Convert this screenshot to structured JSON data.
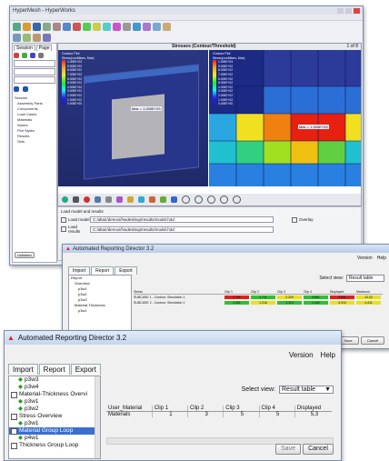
{
  "bg_window": {
    "title": "HyperMesh - HyperWorks",
    "sidebar_tabs": [
      "Session",
      "Page"
    ],
    "tree_items": [
      "Session",
      "Assembly Parts",
      "Components",
      "Load Cases",
      "Materials",
      "Nodes",
      "Plot Styles",
      "Results",
      "Sets"
    ],
    "viewport_title": "Stresses (Contour/Threshold)",
    "page_label": "1 of 8",
    "legend_left_title": "Contour Plot",
    "legend_left_sub": "Stress(vonMises, Max)",
    "legend_left_values": [
      "1.000E+03",
      "9.000E+02",
      "8.000E+02",
      "7.000E+02",
      "6.000E+02",
      "5.000E+02",
      "4.000E+02",
      "3.000E+02",
      "2.000E+02",
      "1.000E+02",
      "0.000E+00"
    ],
    "legend_right_title": "Contour Plot",
    "legend_right_sub": "Stress(vonMises, Max)",
    "legend_right_values": [
      "1.000E+03",
      "9.000E+02",
      "8.000E+02",
      "7.000E+02",
      "6.000E+02",
      "5.000E+02",
      "4.000E+02",
      "3.000E+02",
      "2.000E+02",
      "1.000E+02",
      "0.000E+00"
    ],
    "tag_left": "Max = 1.000E+03",
    "tag_right": "Max = 1.000E+03",
    "load_label": "Load model and results",
    "load_model_label": "Load model",
    "load_results_label": "Load results",
    "model_path": "C:/altair/demos/hwdesktop/results/model.h3d",
    "results_path": "C:/altair/demos/hwdesktop/results/model.h3d",
    "overlay_label": "Overlay",
    "bottom_btn": "Unlinked"
  },
  "mid_window": {
    "title": "Automated Reporting Director 3.2",
    "menu": [
      "Version",
      "Help"
    ],
    "tabs": [
      "Import",
      "Report",
      "Export"
    ],
    "tree": [
      "Report",
      "Overview",
      "p3w1",
      "p3w2",
      "p3w3",
      "Material-Thickness",
      "p3w1"
    ],
    "select_view_label": "Select view:",
    "select_view_value": "Result table",
    "table_header": [
      "Stress",
      "Clip 1",
      "Clip 2",
      "Clip 3",
      "Clip 4",
      "Displayed",
      "Maximum"
    ],
    "rows": [
      {
        "label": "SUBCASE 1 - Contour: Simulation 1",
        "cells": [
          "2.101",
          "1.711",
          "2.320",
          "5.891",
          "3.841",
          "12.42"
        ]
      },
      {
        "label": "SUBCASE 2 - Contour: Simulation 1",
        "cells": [
          "1.431",
          "1.216",
          "1.110",
          "1.402",
          "4.910",
          "4.411"
        ]
      }
    ],
    "save_label": "Save",
    "cancel_label": "Cancel"
  },
  "front_window": {
    "title": "Automated Reporting Director 3.2",
    "menu": [
      "Version",
      "Help"
    ],
    "tabs": [
      "Import",
      "Report",
      "Export"
    ],
    "tree": [
      {
        "label": "p3w3",
        "type": "leaf"
      },
      {
        "label": "p3w4",
        "type": "leaf"
      },
      {
        "label": "Material-Thickness Overvi",
        "type": "folder"
      },
      {
        "label": "p3w1",
        "type": "leaf"
      },
      {
        "label": "p3w2",
        "type": "leaf"
      },
      {
        "label": "Stress Overview",
        "type": "folder"
      },
      {
        "label": "p3w1",
        "type": "leaf"
      },
      {
        "label": "Material Group Loop",
        "type": "folder",
        "selected": true
      },
      {
        "label": "p4w1",
        "type": "leaf"
      },
      {
        "label": "Thickness Group Loop",
        "type": "folder"
      }
    ],
    "select_view_label": "Select view:",
    "select_view_value": "Result table",
    "table_header": [
      "User_Material",
      "Clip 1",
      "Clip 2",
      "Clip 3",
      "Clip 4",
      "Displayed"
    ],
    "table_row": [
      "Materials",
      "1",
      "3",
      "5",
      "5",
      "5,3"
    ],
    "save_label": "Save",
    "cancel_label": "Cancel",
    "colors": {
      "selected": "#3a6fd0",
      "title_red": "#cc2222"
    }
  }
}
